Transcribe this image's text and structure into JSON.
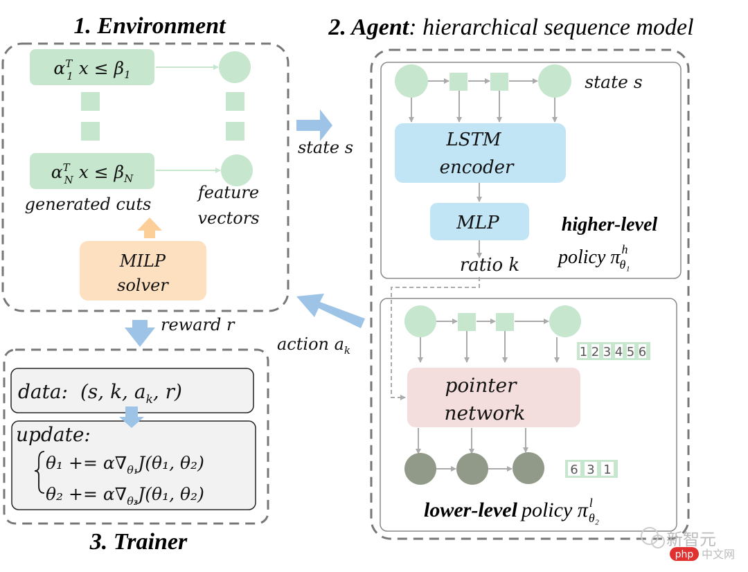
{
  "environment": {
    "title": "1. Environment",
    "cut_1": "α",
    "cut_1_sup": "T",
    "cut_1_sub": "1",
    "cut_1_rest": "x ≤ β",
    "cut_1_beta_sub": "1",
    "cut_n_sub": "N",
    "cut_n_beta_sub": "N",
    "generated_cuts_label": "generated cuts",
    "feature_label_1": "feature",
    "feature_label_2": "vectors",
    "solver_label_1": "MILP",
    "solver_label_2": "solver"
  },
  "arrows": {
    "state_label": "state s",
    "reward_label": "reward r",
    "action_label": "action a",
    "action_sub": "k"
  },
  "agent": {
    "title_bold": "2. Agent",
    "title_rest": ": hierarchical sequence model",
    "higher": {
      "state_label": "state s",
      "encoder_label_1": "LSTM",
      "encoder_label_2": "encoder",
      "mlp_label": "MLP",
      "ratio_label": "ratio k",
      "level_label": "higher-level",
      "policy_label": "policy π",
      "policy_sup": "h",
      "policy_sub": "θ₁"
    },
    "lower": {
      "pointer_label_1": "pointer",
      "pointer_label_2": "network",
      "input_indices": [
        "1",
        "2",
        "3",
        "4",
        "5",
        "6"
      ],
      "output_indices": [
        "6",
        "3",
        "1"
      ],
      "level_label": "lower-level",
      "policy_label": "policy π",
      "policy_sup": "l",
      "policy_sub": "θ₂"
    }
  },
  "trainer": {
    "title": "3. Trainer",
    "data_label": "data:",
    "data_tuple": "(s, k, a",
    "data_tuple_sub": "k",
    "data_tuple_end": ", r)",
    "update_label": "update:",
    "update_1": "θ₁ += α∇",
    "update_1_sub": "θ₁",
    "update_1_end": "J(θ₁, θ₂)",
    "update_2": "θ₂ += α∇",
    "update_2_sub": "θ₂",
    "update_2_end": "J(θ₁, θ₂)"
  },
  "watermark": {
    "brand": "新智元",
    "site_badge": "php",
    "site_text": "中文网"
  },
  "colors": {
    "green": "#c6e6cd",
    "orange": "#fde0bf",
    "blue_box": "#c2e5f5",
    "pink": "#f4dedd",
    "dark_node": "#919a88",
    "arrow_blue": "#9dc3e6",
    "grey_dash": "#777777"
  }
}
